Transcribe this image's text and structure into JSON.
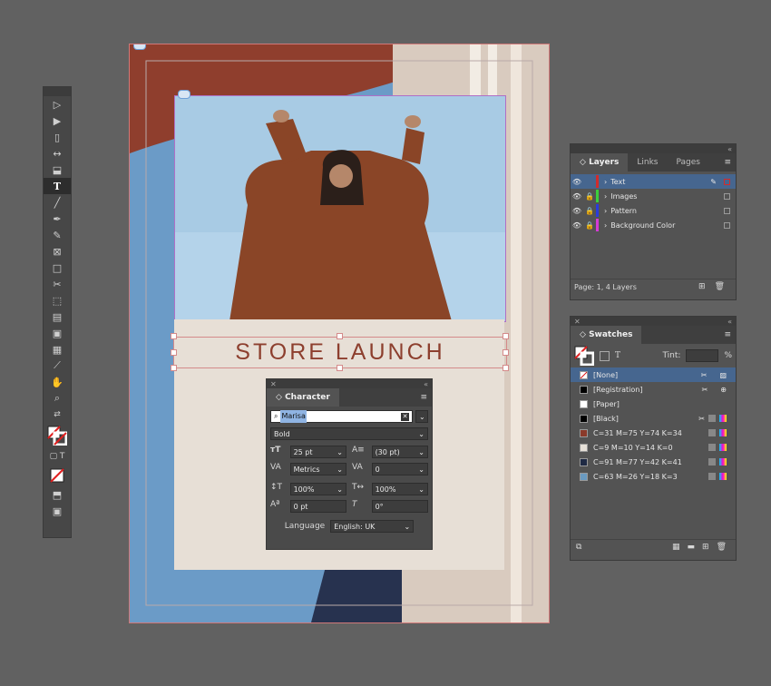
{
  "document": {
    "headline": "STORE LAUNCH"
  },
  "character_panel": {
    "title": "Character",
    "font_family": "Marisa",
    "font_style": "Bold",
    "font_size": "25 pt",
    "leading": "(30 pt)",
    "kerning": "Metrics",
    "tracking": "0",
    "vertical_scale": "100%",
    "horizontal_scale": "100%",
    "baseline_shift": "0 pt",
    "skew": "0°",
    "language_label": "Language",
    "language_value": "English: UK"
  },
  "layers_panel": {
    "tabs": [
      "Layers",
      "Links",
      "Pages"
    ],
    "layers": [
      {
        "name": "Text",
        "color": "#d12c2c",
        "locked": false,
        "selected": true
      },
      {
        "name": "Images",
        "color": "#3ccf3c",
        "locked": true,
        "selected": false
      },
      {
        "name": "Pattern",
        "color": "#2a3bdc",
        "locked": true,
        "selected": false
      },
      {
        "name": "Background Color",
        "color": "#d63bd6",
        "locked": true,
        "selected": false
      }
    ],
    "footer": "Page: 1, 4 Layers"
  },
  "swatches_panel": {
    "title": "Swatches",
    "tint_label": "Tint:",
    "tint_unit": "%",
    "swatches": [
      {
        "name": "[None]",
        "color": "none",
        "selected": true
      },
      {
        "name": "[Registration]",
        "color": "#000000",
        "selected": false
      },
      {
        "name": "[Paper]",
        "color": "#ffffff",
        "selected": false
      },
      {
        "name": "[Black]",
        "color": "#000000",
        "selected": false
      },
      {
        "name": "C=31 M=75 Y=74 K=34",
        "color": "#8a3a2a",
        "selected": false
      },
      {
        "name": "C=9 M=10 Y=14 K=0",
        "color": "#e6e0d8",
        "selected": false
      },
      {
        "name": "C=91 M=77 Y=42 K=41",
        "color": "#1f2a44",
        "selected": false
      },
      {
        "name": "C=63 M=26 Y=18 K=3",
        "color": "#6a9ac0",
        "selected": false
      }
    ]
  },
  "colors": {
    "headline": "#8d3f2e",
    "rust": "#8f3e2d",
    "navy": "#27324f",
    "sky": "#6b9bc7",
    "beige": "#e7dfd6",
    "selection": "#46668f"
  }
}
